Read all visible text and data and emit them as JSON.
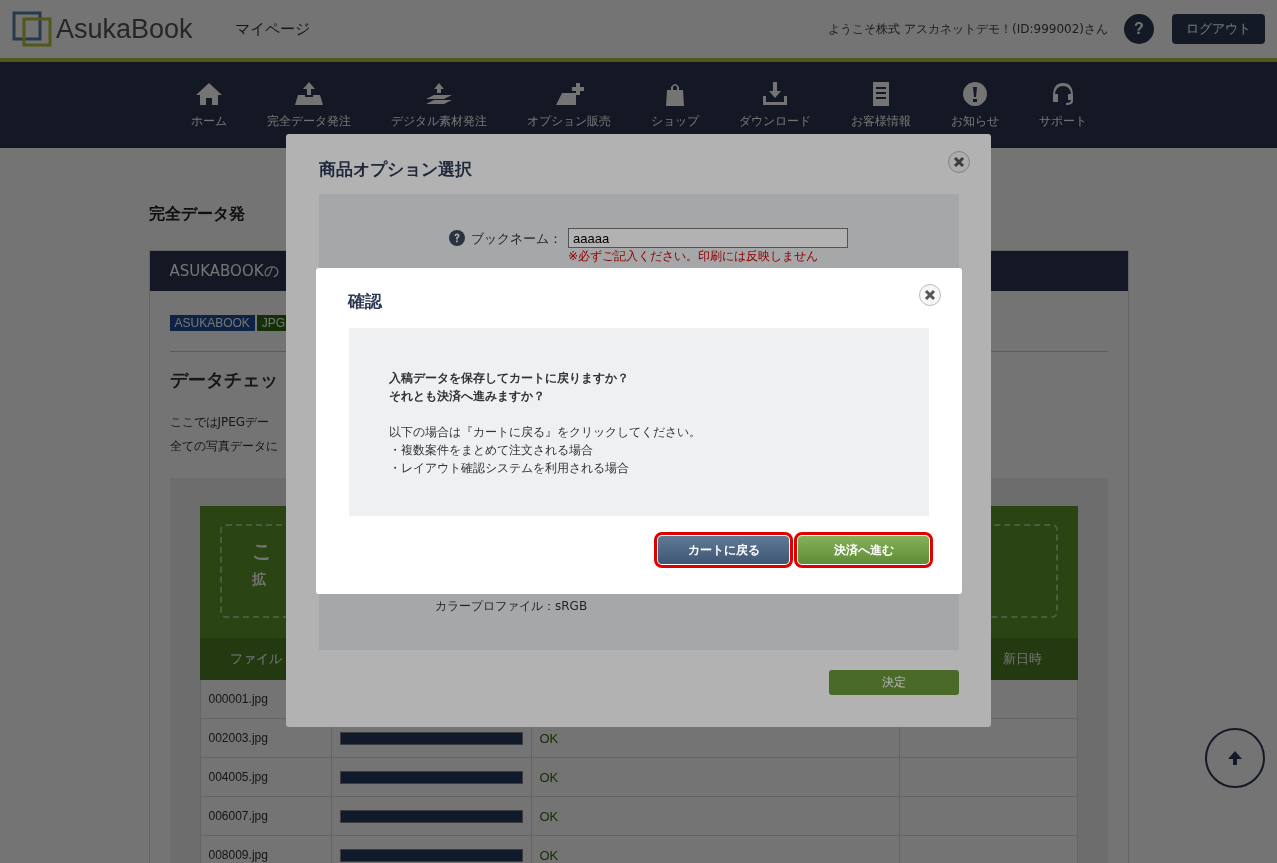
{
  "header": {
    "logo": "AsukaBook",
    "page_title": "マイページ",
    "welcome": "ようこそ株式 アスカネットデモ！(ID:999002)さん",
    "help": "?",
    "logout": "ログアウト"
  },
  "nav": [
    {
      "label": "ホーム",
      "kind": "home"
    },
    {
      "label": "完全データ発注",
      "kind": "upload"
    },
    {
      "label": "デジタル素材発注",
      "kind": "layers"
    },
    {
      "label": "オプション販売",
      "kind": "plus"
    },
    {
      "label": "ショップ",
      "kind": "bag"
    },
    {
      "label": "ダウンロード",
      "kind": "download"
    },
    {
      "label": "お客様情報",
      "kind": "doc"
    },
    {
      "label": "お知らせ",
      "kind": "alert"
    },
    {
      "label": "サポート",
      "kind": "headset"
    }
  ],
  "page": {
    "title": "完全データ発",
    "panel_title": "ASUKABOOKの",
    "tags": [
      {
        "label": "ASUKABOOK",
        "kind": "brand"
      },
      {
        "label": "JPG",
        "kind": "format"
      }
    ],
    "heading": "データチェッ",
    "lines": [
      "ここではJPEGデー",
      "全ての写真データに"
    ],
    "dropzone": {
      "line_1": "こ",
      "line_2": "拡"
    },
    "table": {
      "columns": [
        "ファイル",
        "新日時"
      ],
      "rows": [
        {
          "file": "000001.jpg"
        },
        {
          "file": "002003.jpg",
          "level": 1,
          "status": "OK"
        },
        {
          "file": "004005.jpg",
          "level": 1,
          "status": "OK"
        },
        {
          "file": "006007.jpg",
          "level": 1,
          "status": "OK"
        },
        {
          "file": "008009.jpg",
          "level": 1,
          "status": "OK"
        }
      ]
    }
  },
  "option_dialog": {
    "title": "商品オプション選択",
    "field_label": "ブックネーム：",
    "field_value": "aaaaa",
    "note": "※必ずご記入ください。印刷には反映しません",
    "color_profile": "カラープロファイル：sRGB",
    "submit": "決定"
  },
  "confirm_dialog": {
    "title": "確認",
    "question": [
      "入稿データを保存してカートに戻りますか？",
      "それとも決済へ進みますか？"
    ],
    "info": [
      "以下の場合は『カートに戻る』をクリックしてください。",
      "・複数案件をまとめて注文される場合",
      "・レイアウト確認システムを利用される場合"
    ],
    "buttons": [
      {
        "label": "カートに戻る",
        "kind": "back",
        "highlighted": true
      },
      {
        "label": "決済へ進む",
        "kind": "proceed",
        "highlighted": true
      }
    ]
  }
}
